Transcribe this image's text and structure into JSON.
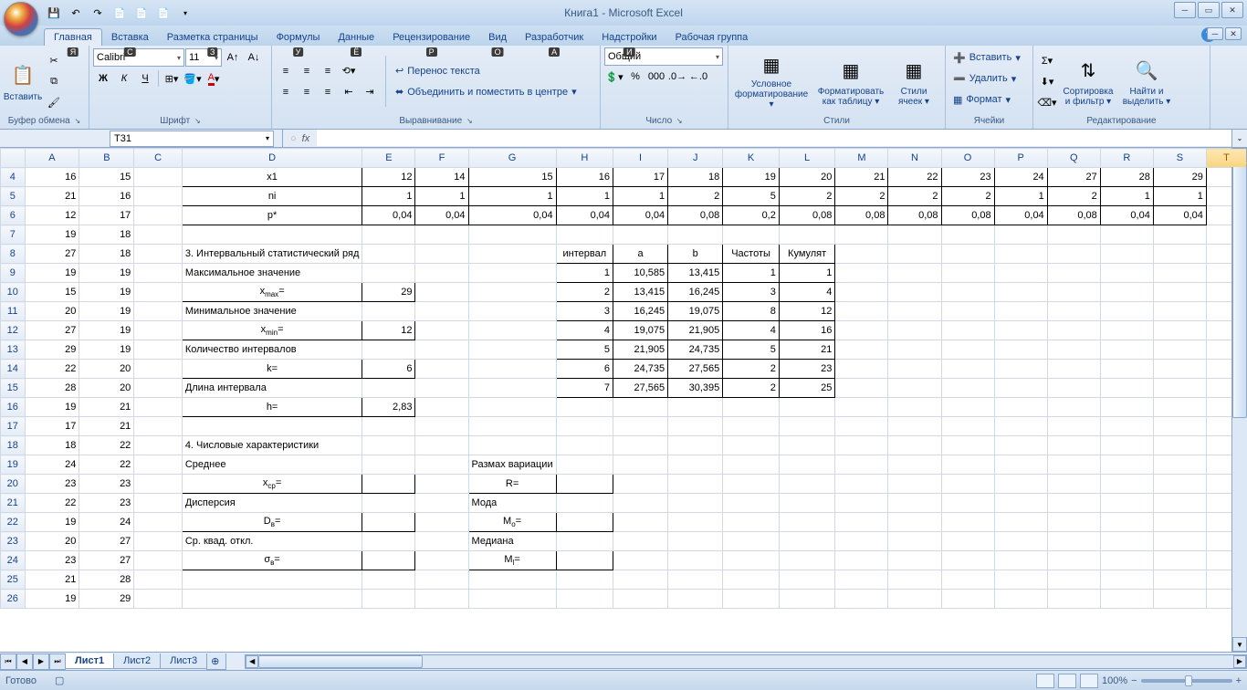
{
  "app": {
    "title": "Книга1 - Microsoft Excel"
  },
  "qat": {
    "save": "💾",
    "undo": "↶",
    "redo": "↷"
  },
  "tabs": {
    "items": [
      "Главная",
      "Вставка",
      "Разметка страницы",
      "Формулы",
      "Данные",
      "Рецензирование",
      "Вид",
      "Разработчик",
      "Надстройки",
      "Рабочая группа"
    ],
    "keytips": [
      "Я",
      "С",
      "З",
      "У",
      "Ё",
      "Р",
      "О",
      "А",
      "И",
      ""
    ],
    "active": 0
  },
  "ribbon": {
    "clipboard": {
      "label": "Буфер обмена",
      "paste": "Вставить"
    },
    "font": {
      "label": "Шрифт",
      "family": "Calibri",
      "size": "11",
      "bold": "Ж",
      "italic": "К",
      "underline": "Ч"
    },
    "alignment": {
      "label": "Выравнивание",
      "wrap": "Перенос текста",
      "merge": "Объединить и поместить в центре"
    },
    "number": {
      "label": "Число",
      "format": "Общий"
    },
    "styles": {
      "label": "Стили",
      "cond": "Условное форматирование",
      "table": "Форматировать как таблицу",
      "cell": "Стили ячеек"
    },
    "cells": {
      "label": "Ячейки",
      "insert": "Вставить",
      "delete": "Удалить",
      "format": "Формат"
    },
    "editing": {
      "label": "Редактирование",
      "sort": "Сортировка и фильтр",
      "find": "Найти и выделить"
    }
  },
  "namebox": "T31",
  "cols": [
    "A",
    "B",
    "C",
    "D",
    "E",
    "F",
    "G",
    "H",
    "I",
    "J",
    "K",
    "L",
    "M",
    "N",
    "O",
    "P",
    "Q",
    "R",
    "S",
    "T"
  ],
  "rows": [
    4,
    5,
    6,
    7,
    8,
    9,
    10,
    11,
    12,
    13,
    14,
    15,
    16,
    17,
    18,
    19,
    20,
    21,
    22,
    23,
    24,
    25,
    26
  ],
  "colA": {
    "4": "16",
    "5": "21",
    "6": "12",
    "7": "19",
    "8": "27",
    "9": "19",
    "10": "15",
    "11": "20",
    "12": "27",
    "13": "29",
    "14": "22",
    "15": "28",
    "16": "19",
    "17": "17",
    "18": "18",
    "19": "24",
    "20": "23",
    "21": "22",
    "22": "19",
    "23": "20",
    "24": "23",
    "25": "21",
    "26": "19"
  },
  "colB": {
    "4": "15",
    "5": "16",
    "6": "17",
    "7": "18",
    "8": "18",
    "9": "19",
    "10": "19",
    "11": "19",
    "12": "19",
    "13": "19",
    "14": "20",
    "15": "20",
    "16": "21",
    "17": "21",
    "18": "22",
    "19": "22",
    "20": "23",
    "21": "23",
    "22": "24",
    "23": "27",
    "24": "27",
    "25": "28",
    "26": "29"
  },
  "row4": {
    "D": "x1",
    "E": "12",
    "F": "14",
    "G": "15",
    "H": "16",
    "I": "17",
    "J": "18",
    "K": "19",
    "L": "20",
    "M": "21",
    "N": "22",
    "O": "23",
    "P": "24",
    "Q": "27",
    "R": "28",
    "S": "29"
  },
  "row5": {
    "D": "ni",
    "E": "1",
    "F": "1",
    "G": "1",
    "H": "1",
    "I": "1",
    "J": "2",
    "K": "5",
    "L": "2",
    "M": "2",
    "N": "2",
    "O": "2",
    "P": "1",
    "Q": "2",
    "R": "1",
    "S": "1"
  },
  "row6": {
    "D": "p*",
    "E": "0,04",
    "F": "0,04",
    "G": "0,04",
    "H": "0,04",
    "I": "0,04",
    "J": "0,08",
    "K": "0,2",
    "L": "0,08",
    "M": "0,08",
    "N": "0,08",
    "O": "0,08",
    "P": "0,04",
    "Q": "0,08",
    "R": "0,04",
    "S": "0,04"
  },
  "labels": {
    "section3": "3. Интервальный статистический ряд",
    "max": "Максимальное значение",
    "xmax": "xmax=",
    "xmax_v": "29",
    "min": "Минимальное значение",
    "xmin": "xmin=",
    "xmin_v": "12",
    "count": "Количество интервалов",
    "k": "k=",
    "k_v": "6",
    "len": "Длина интервала",
    "h": "h=",
    "h_v": "2,83",
    "section4": "4. Числовые характеристики",
    "mean": "Среднее",
    "xcp": "xcp=",
    "disp": "Дисперсия",
    "dv": "Dв=",
    "sko": "Ср. квад. откл.",
    "sigma": "σв=",
    "range": "Размах вариации",
    "R": "R=",
    "mode": "Мода",
    "Mo": "Mo=",
    "median": "Медиана",
    "Ml": "Ml="
  },
  "interval_table": {
    "headers": [
      "интервал",
      "a",
      "b",
      "Частоты",
      "Кумулят"
    ],
    "rows": [
      [
        "1",
        "10,585",
        "13,415",
        "1",
        "1"
      ],
      [
        "2",
        "13,415",
        "16,245",
        "3",
        "4"
      ],
      [
        "3",
        "16,245",
        "19,075",
        "8",
        "12"
      ],
      [
        "4",
        "19,075",
        "21,905",
        "4",
        "16"
      ],
      [
        "5",
        "21,905",
        "24,735",
        "5",
        "21"
      ],
      [
        "6",
        "24,735",
        "27,565",
        "2",
        "23"
      ],
      [
        "7",
        "27,565",
        "30,395",
        "2",
        "25"
      ]
    ]
  },
  "sheets": [
    "Лист1",
    "Лист2",
    "Лист3"
  ],
  "status": {
    "ready": "Готово",
    "zoom": "100%"
  },
  "selected": {
    "col": "T",
    "row_label": "31"
  }
}
